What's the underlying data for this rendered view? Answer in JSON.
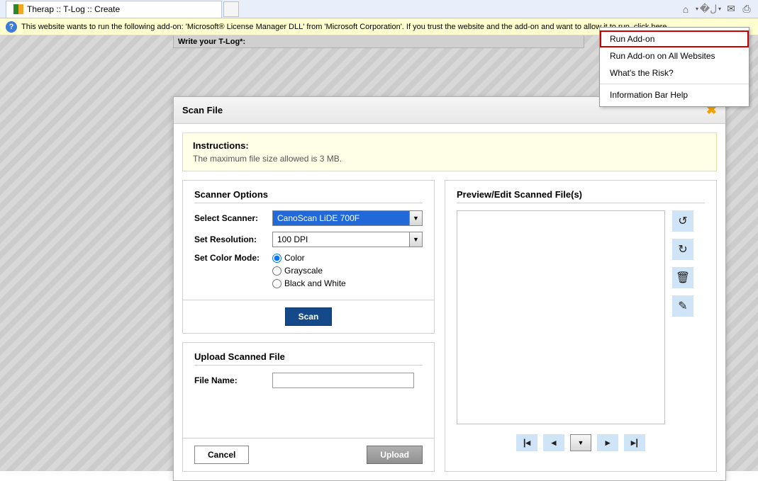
{
  "browser": {
    "tab_title": "Therap :: T-Log :: Create",
    "infobar_text": "This website wants to run the following add-on: 'Microsoft® License Manager DLL' from 'Microsoft Corporation'. If you trust the website and the add-on and want to allow it to run, click here..."
  },
  "addon_menu": {
    "items": [
      "Run Add-on",
      "Run Add-on on All Websites",
      "What's the Risk?",
      "Information Bar Help"
    ]
  },
  "partial_header": "Write your T-Log*:",
  "modal": {
    "title": "Scan File",
    "instructions_heading": "Instructions:",
    "instructions_text": "The maximum file size allowed is 3 MB.",
    "scanner_options_heading": "Scanner Options",
    "select_scanner_label": "Select Scanner:",
    "select_scanner_value": "CanoScan LiDE 700F",
    "set_resolution_label": "Set Resolution:",
    "set_resolution_value": "100 DPI",
    "set_color_label": "Set Color Mode:",
    "color_options": [
      "Color",
      "Grayscale",
      "Black and White"
    ],
    "scan_button": "Scan",
    "upload_heading": "Upload Scanned File",
    "file_name_label": "File Name:",
    "cancel_button": "Cancel",
    "upload_button": "Upload",
    "preview_heading": "Preview/Edit Scanned File(s)"
  }
}
